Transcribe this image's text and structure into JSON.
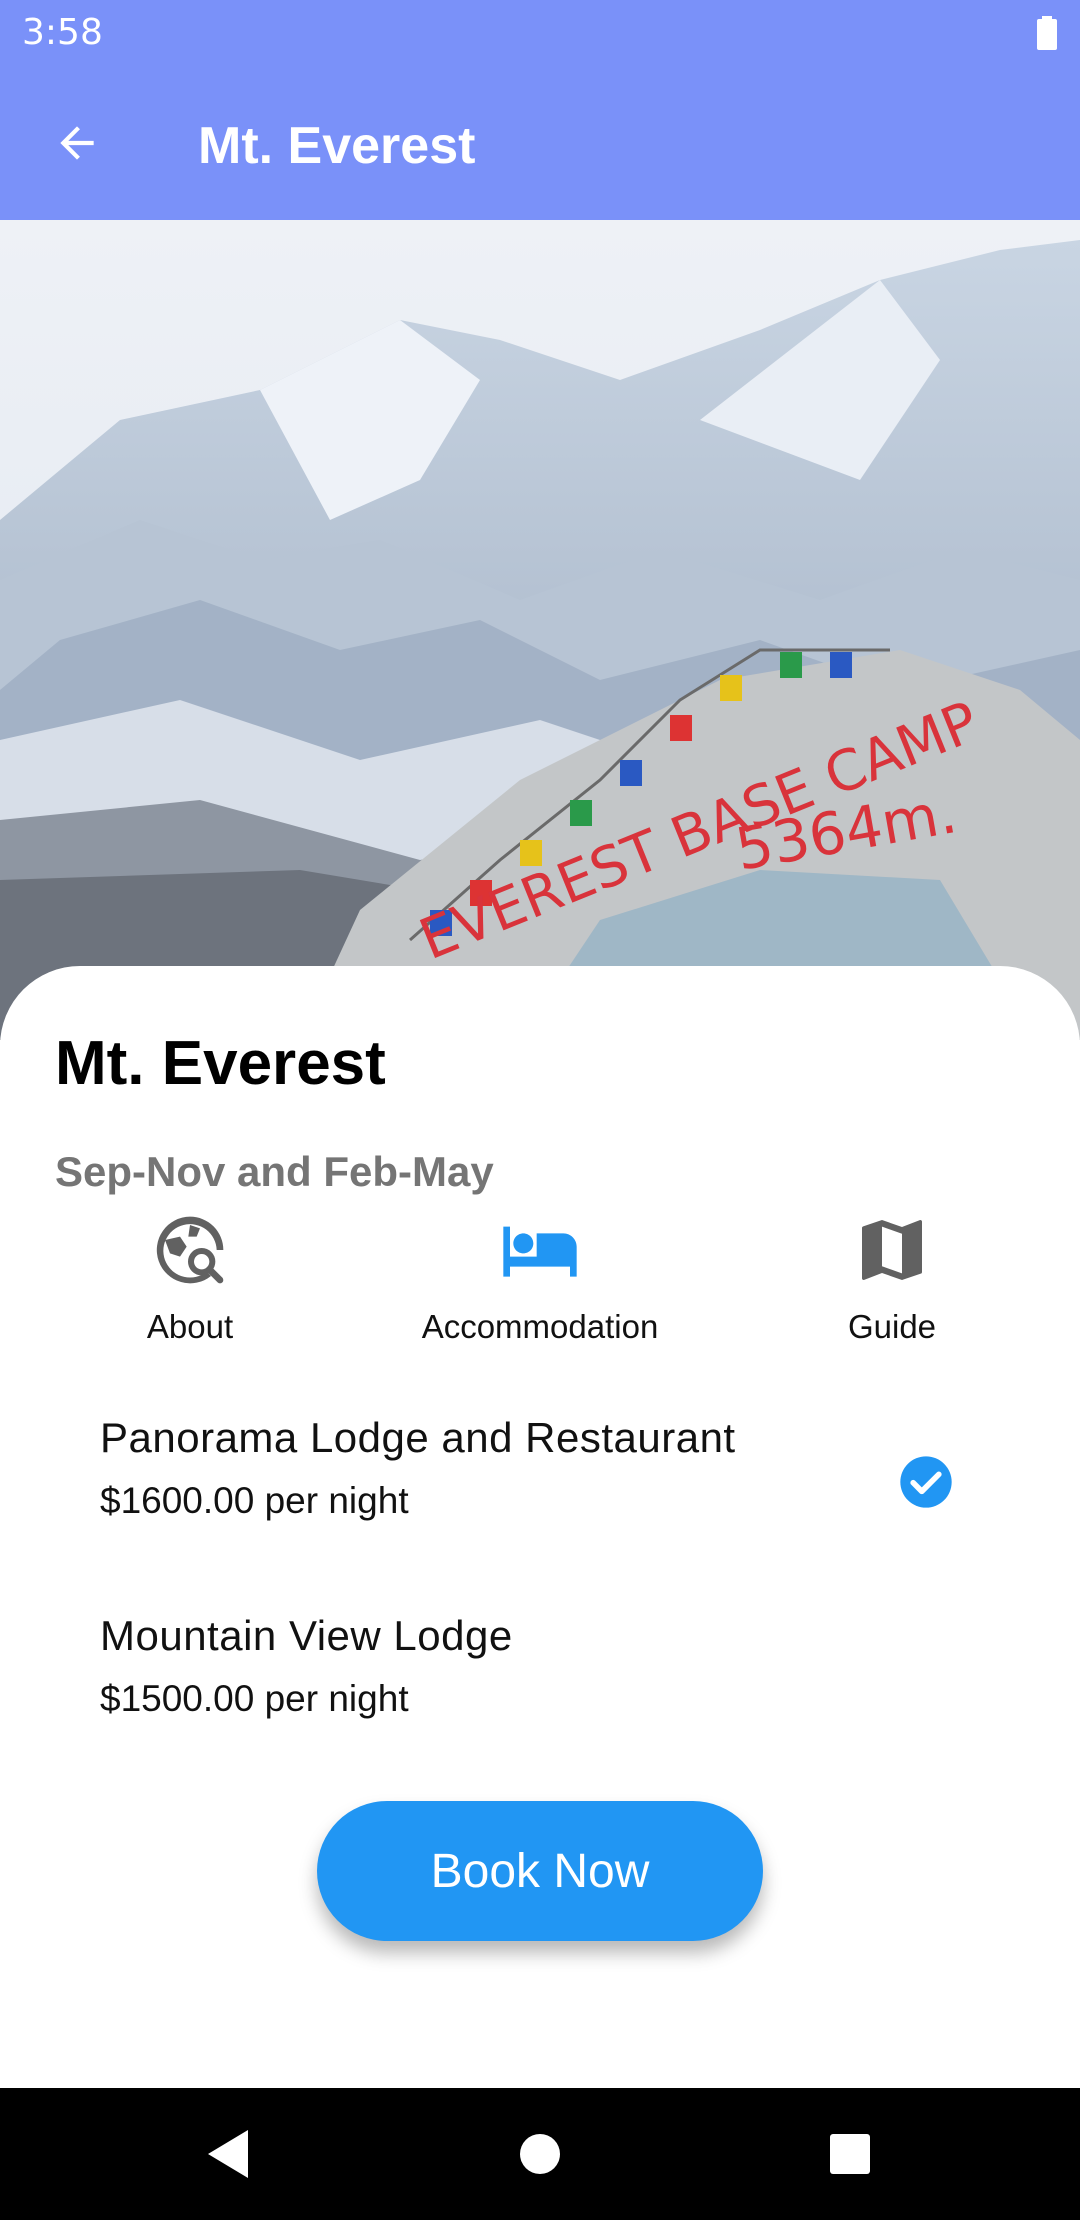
{
  "status_bar": {
    "time": "3:58",
    "battery_icon": "battery-full-icon"
  },
  "app_bar": {
    "title": "Mt. Everest",
    "back_icon": "arrow-left-icon"
  },
  "hero": {
    "image": "everest-base-camp-photo",
    "sign_text": "EVEREST BASE CAMP",
    "sign_altitude": "5364m."
  },
  "details": {
    "name": "Mt. Everest",
    "season": "Sep-Nov and Feb-May",
    "tabs": [
      {
        "label": "About",
        "icon": "travel-explore-icon",
        "active": false
      },
      {
        "label": "Accommodation",
        "icon": "bed-icon",
        "active": true
      },
      {
        "label": "Guide",
        "icon": "map-icon",
        "active": false
      }
    ],
    "lodges": [
      {
        "name": "Panorama Lodge and Restaurant",
        "price": "$1600.00 per night",
        "selected": true
      },
      {
        "name": "Mountain View Lodge",
        "price": "$1500.00 per night",
        "selected": false
      }
    ],
    "book_label": "Book Now"
  },
  "colors": {
    "app_bar": "#7a91f9",
    "accent": "#2196f3",
    "inactive_icon": "#616161"
  },
  "nav_bar": {
    "back": "nav-back-icon",
    "home": "nav-home-icon",
    "recents": "nav-recents-icon"
  }
}
